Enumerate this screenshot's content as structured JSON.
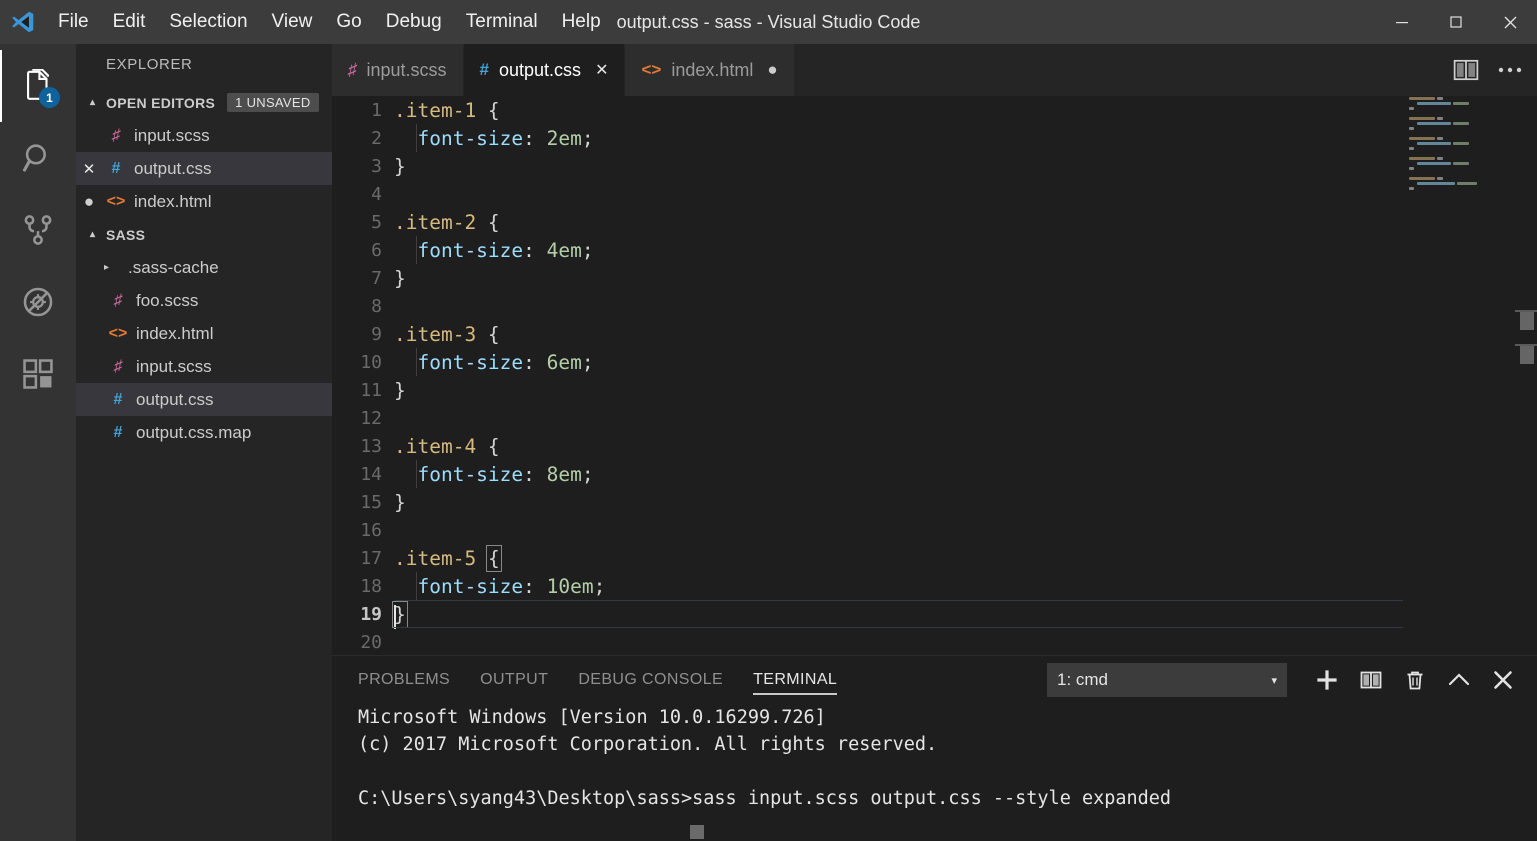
{
  "window": {
    "title": "output.css - sass - Visual Studio Code",
    "logo_icon": "vscode-logo-icon",
    "minimize_label": "─",
    "maximize_label": "□",
    "close_label": "✕"
  },
  "menubar": {
    "items": [
      {
        "label": "File"
      },
      {
        "label": "Edit"
      },
      {
        "label": "Selection"
      },
      {
        "label": "View"
      },
      {
        "label": "Go"
      },
      {
        "label": "Debug"
      },
      {
        "label": "Terminal"
      },
      {
        "label": "Help"
      }
    ]
  },
  "activitybar": {
    "items": [
      {
        "name": "explorer",
        "icon": "files-icon",
        "active": true,
        "badge": "1"
      },
      {
        "name": "search",
        "icon": "search-icon",
        "active": false,
        "badge": ""
      },
      {
        "name": "source-control",
        "icon": "source-control-icon",
        "active": false,
        "badge": ""
      },
      {
        "name": "debug",
        "icon": "debug-no-bug-icon",
        "active": false,
        "badge": ""
      },
      {
        "name": "extensions",
        "icon": "extensions-icon",
        "active": false,
        "badge": ""
      }
    ]
  },
  "sidebar": {
    "title": "EXPLORER",
    "open_editors": {
      "label": "OPEN EDITORS",
      "badge": "1 UNSAVED",
      "items": [
        {
          "label": "input.scss",
          "icon": "scss-file-icon",
          "state": "none",
          "selected": false
        },
        {
          "label": "output.css",
          "icon": "css-file-icon",
          "state": "close",
          "selected": true
        },
        {
          "label": "index.html",
          "icon": "html-file-icon",
          "state": "dirty",
          "selected": false
        }
      ]
    },
    "folder": {
      "label": "SASS",
      "items": [
        {
          "label": ".sass-cache",
          "icon": "folder-icon",
          "kind": "folder",
          "selected": false
        },
        {
          "label": "foo.scss",
          "icon": "scss-file-icon",
          "kind": "file",
          "selected": false
        },
        {
          "label": "index.html",
          "icon": "html-file-icon",
          "kind": "file",
          "selected": false
        },
        {
          "label": "input.scss",
          "icon": "scss-file-icon",
          "kind": "file",
          "selected": false
        },
        {
          "label": "output.css",
          "icon": "css-file-icon",
          "kind": "file",
          "selected": true
        },
        {
          "label": "output.css.map",
          "icon": "css-file-icon",
          "kind": "file",
          "selected": false
        }
      ]
    }
  },
  "editor": {
    "tabs": [
      {
        "label": "input.scss",
        "icon": "scss-file-icon",
        "active": false,
        "dirty": false,
        "closable": false
      },
      {
        "label": "output.css",
        "icon": "css-file-icon",
        "active": true,
        "dirty": false,
        "closable": true
      },
      {
        "label": "index.html",
        "icon": "html-file-icon",
        "active": false,
        "dirty": true,
        "closable": false
      }
    ],
    "actions": [
      {
        "name": "split-editor",
        "icon": "split-editor-icon"
      },
      {
        "name": "more-actions",
        "icon": "ellipsis-icon"
      }
    ],
    "current_line": 19,
    "lines": [
      {
        "n": "1",
        "selector": ".item-1",
        "brace": " {",
        "indent": false,
        "type": "open"
      },
      {
        "n": "2",
        "prop": "font-size",
        "value": "2em",
        "indent": true,
        "type": "decl"
      },
      {
        "n": "3",
        "close": "}",
        "indent": false,
        "type": "close"
      },
      {
        "n": "4",
        "type": "blank"
      },
      {
        "n": "5",
        "selector": ".item-2",
        "brace": " {",
        "indent": false,
        "type": "open"
      },
      {
        "n": "6",
        "prop": "font-size",
        "value": "4em",
        "indent": true,
        "type": "decl"
      },
      {
        "n": "7",
        "close": "}",
        "indent": false,
        "type": "close"
      },
      {
        "n": "8",
        "type": "blank"
      },
      {
        "n": "9",
        "selector": ".item-3",
        "brace": " {",
        "indent": false,
        "type": "open"
      },
      {
        "n": "10",
        "prop": "font-size",
        "value": "6em",
        "indent": true,
        "type": "decl"
      },
      {
        "n": "11",
        "close": "}",
        "indent": false,
        "type": "close"
      },
      {
        "n": "12",
        "type": "blank"
      },
      {
        "n": "13",
        "selector": ".item-4",
        "brace": " {",
        "indent": false,
        "type": "open"
      },
      {
        "n": "14",
        "prop": "font-size",
        "value": "8em",
        "indent": true,
        "type": "decl"
      },
      {
        "n": "15",
        "close": "}",
        "indent": false,
        "type": "close"
      },
      {
        "n": "16",
        "type": "blank"
      },
      {
        "n": "17",
        "selector": ".item-5",
        "brace": " {",
        "indent": false,
        "type": "open",
        "bracket_match": true
      },
      {
        "n": "18",
        "prop": "font-size",
        "value": "10em",
        "indent": true,
        "type": "decl"
      },
      {
        "n": "19",
        "close": "}",
        "indent": false,
        "type": "close",
        "bracket_match": true,
        "current": true
      },
      {
        "n": "20",
        "type": "blank"
      }
    ]
  },
  "panel": {
    "tabs": [
      {
        "label": "PROBLEMS",
        "active": false
      },
      {
        "label": "OUTPUT",
        "active": false
      },
      {
        "label": "DEBUG CONSOLE",
        "active": false
      },
      {
        "label": "TERMINAL",
        "active": true
      }
    ],
    "terminal_select": {
      "value": "1: cmd",
      "arrow": "▾"
    },
    "actions": [
      {
        "name": "new-terminal",
        "icon": "plus-icon"
      },
      {
        "name": "split-terminal",
        "icon": "split-icon"
      },
      {
        "name": "kill-terminal",
        "icon": "trash-icon"
      },
      {
        "name": "maximize-panel",
        "icon": "chevron-up-icon"
      },
      {
        "name": "close-panel",
        "icon": "close-icon"
      }
    ],
    "terminal_lines": [
      "Microsoft Windows [Version 10.0.16299.726]",
      "(c) 2017 Microsoft Corporation. All rights reserved.",
      "",
      "C:\\Users\\syang43\\Desktop\\sass>sass input.scss output.css --style expanded"
    ]
  },
  "colors": {
    "titlebar_bg": "#3c3c3c",
    "activitybar_bg": "#333333",
    "sidebar_bg": "#252526",
    "editor_bg": "#1e1e1e",
    "tab_inactive_bg": "#2d2d2d",
    "accent_badge": "#0e639c",
    "selector_token": "#d7ba7d",
    "property_token": "#9cdcfe",
    "value_token": "#b5cea8",
    "scss_icon": "#cd6799",
    "css_icon": "#42a5d8",
    "html_icon": "#e37933"
  }
}
